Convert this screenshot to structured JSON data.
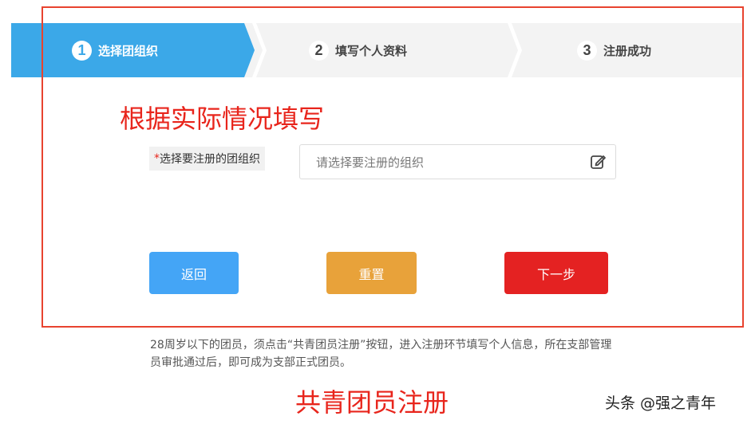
{
  "steps": [
    {
      "number": "1",
      "label": "选择团组织",
      "state": "active"
    },
    {
      "number": "2",
      "label": "填写个人资料",
      "state": "inactive"
    },
    {
      "number": "3",
      "label": "注册成功",
      "state": "inactive"
    }
  ],
  "annotation": {
    "fill_hint": "根据实际情况填写",
    "caption": "共青团员注册"
  },
  "form": {
    "required_mark": "*",
    "org_label": "选择要注册的团组织",
    "org_placeholder": "请选择要注册的组织",
    "edit_icon": "edit-icon"
  },
  "buttons": {
    "back": "返回",
    "reset": "重置",
    "next": "下一步"
  },
  "note": {
    "text": "28周岁以下的团员，须点击“共青团员注册”按钮，进入注册环节填写个人信息，所在支部管理员审批通过后，即可成为支部正式团员。"
  },
  "watermark": "头条 @强之青年",
  "colors": {
    "accent_blue": "#3ba8e8",
    "annotation_red": "#e8251c",
    "back_button": "#44a5f6",
    "reset_button": "#e8a23a",
    "next_button": "#e42222"
  }
}
